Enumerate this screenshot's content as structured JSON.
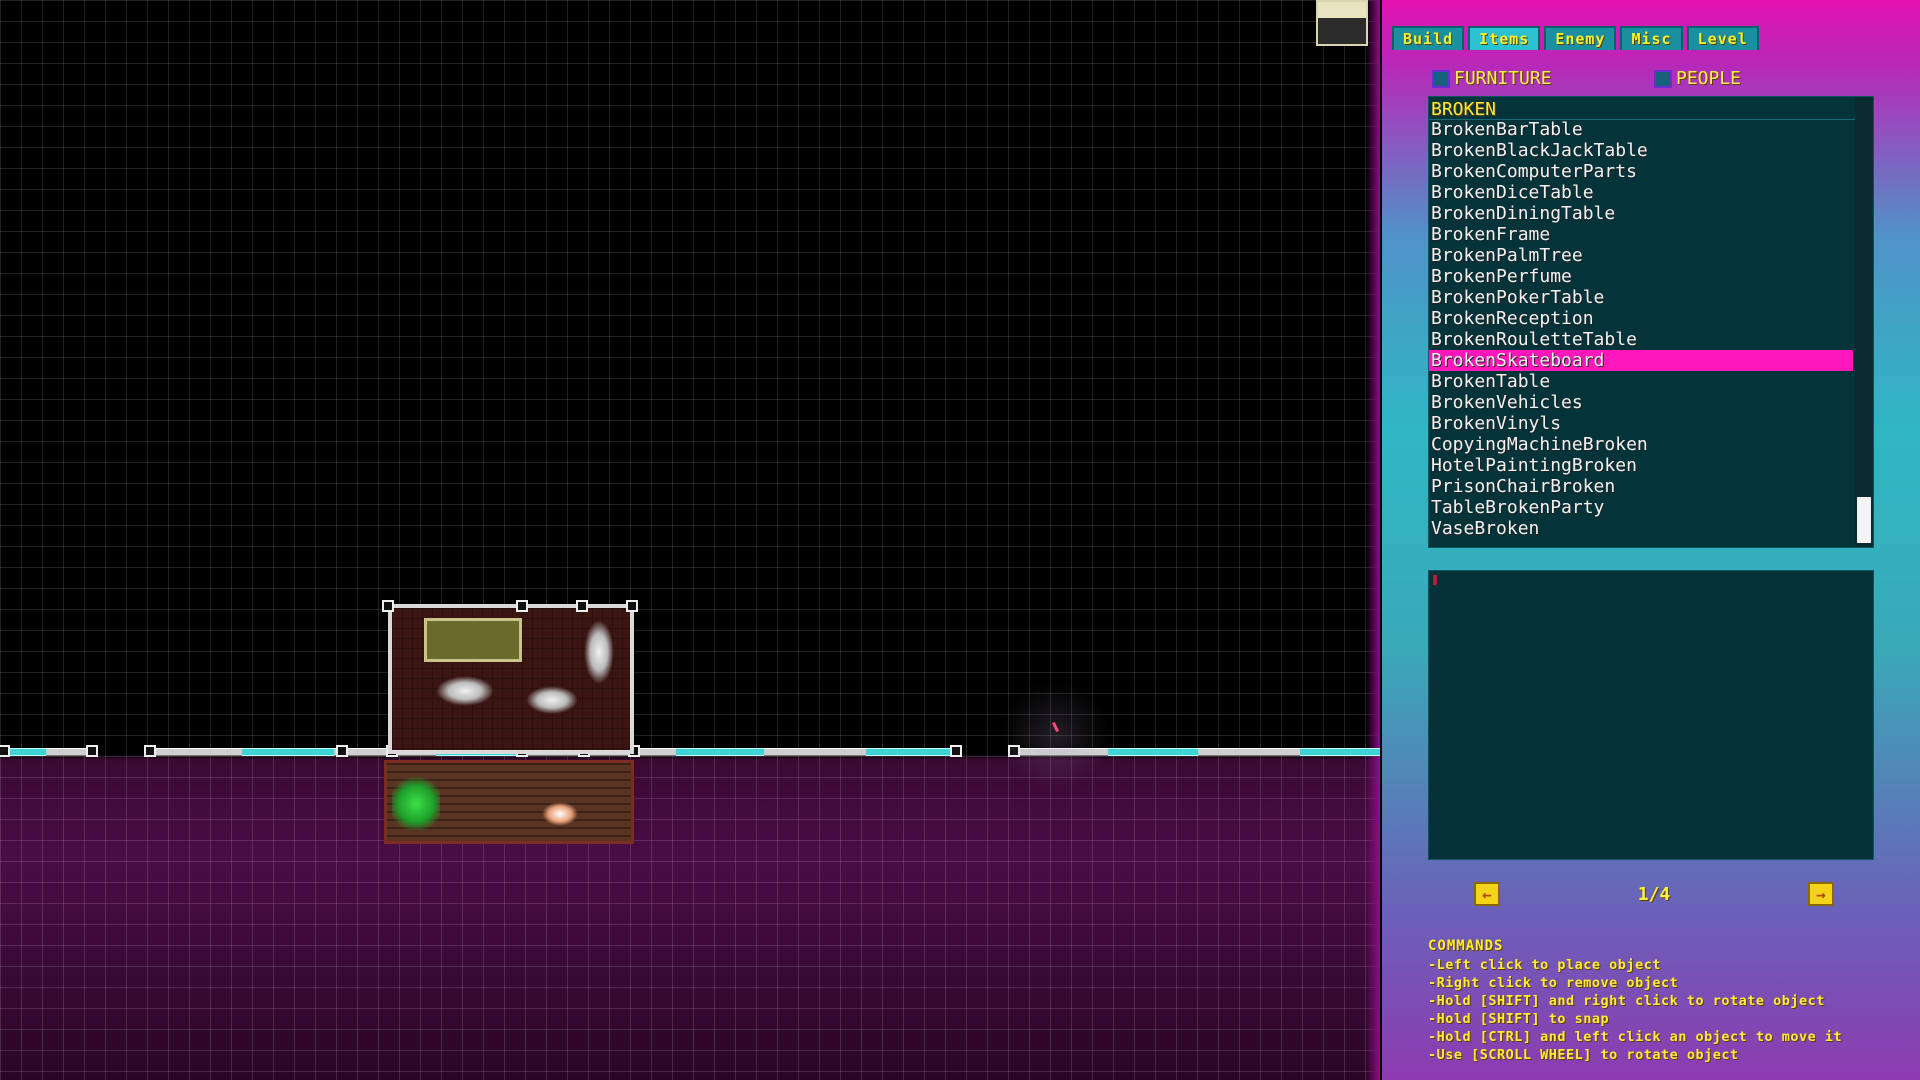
{
  "tabs": [
    "Build",
    "Items",
    "Enemy",
    "Misc",
    "Level"
  ],
  "active_tab": "Items",
  "filters": {
    "furniture_label": "FURNITURE",
    "people_label": "PEOPLE"
  },
  "list": {
    "category": "BROKEN",
    "items": [
      "BrokenBarTable",
      "BrokenBlackJackTable",
      "BrokenComputerParts",
      "BrokenDiceTable",
      "BrokenDiningTable",
      "BrokenFrame",
      "BrokenPalmTree",
      "BrokenPerfume",
      "BrokenPokerTable",
      "BrokenReception",
      "BrokenRouletteTable",
      "BrokenSkateboard",
      "BrokenTable",
      "BrokenVehicles",
      "BrokenVinyls",
      "CopyingMachineBroken",
      "HotelPaintingBroken",
      "PrisonChairBroken",
      "TableBrokenParty",
      "VaseBroken"
    ],
    "selected": "BrokenSkateboard"
  },
  "pager": {
    "label": "1/4",
    "prev_icon": "arrow-left-icon",
    "next_icon": "arrow-right-icon"
  },
  "commands": {
    "title": "COMMANDS",
    "lines": [
      "-Left click to place object",
      "-Right click to remove object",
      "-Hold [SHIFT] and right click to rotate object",
      "-Hold [SHIFT] to snap",
      "-Hold [CTRL] and left click an object to move it",
      "-Use [SCROLL WHEEL] to rotate object"
    ]
  },
  "colors": {
    "selection": "#ff17b9",
    "accent_text": "#ffef52",
    "list_bg": "#05333a"
  }
}
